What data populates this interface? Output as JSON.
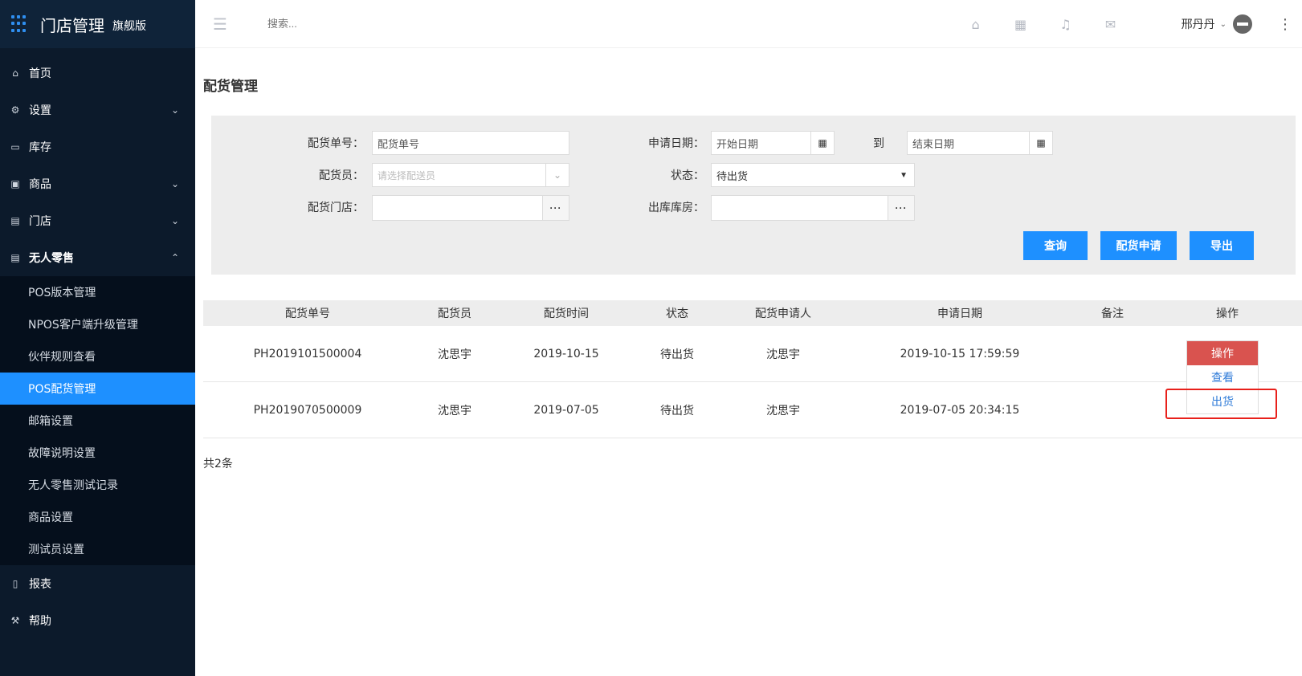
{
  "brand": {
    "title": "门店管理",
    "subtitle": "旗舰版"
  },
  "header": {
    "search_placeholder": "搜索...",
    "user_name": "邢丹丹"
  },
  "sidebar": {
    "items": [
      {
        "label": "首页"
      },
      {
        "label": "设置"
      },
      {
        "label": "库存"
      },
      {
        "label": "商品"
      },
      {
        "label": "门店"
      },
      {
        "label": "无人零售"
      }
    ],
    "sub_items": [
      {
        "label": "POS版本管理"
      },
      {
        "label": "NPOS客户端升级管理"
      },
      {
        "label": "伙伴规则查看"
      },
      {
        "label": "POS配货管理"
      },
      {
        "label": "邮箱设置"
      },
      {
        "label": "故障说明设置"
      },
      {
        "label": "无人零售测试记录"
      },
      {
        "label": "商品设置"
      },
      {
        "label": "测试员设置"
      }
    ],
    "bottom_items": [
      {
        "label": "报表"
      },
      {
        "label": "帮助"
      }
    ]
  },
  "page": {
    "title": "配货管理"
  },
  "filters": {
    "order_no_label": "配货单号：",
    "order_no_placeholder": "配货单号",
    "apply_date_label": "申请日期：",
    "start_date_placeholder": "开始日期",
    "to_label": "到",
    "end_date_placeholder": "结束日期",
    "distributor_label": "配货员：",
    "distributor_placeholder": "请选择配送员",
    "status_label": "状态：",
    "status_value": "待出货",
    "store_label": "配货门店：",
    "warehouse_label": "出库库房：",
    "more_glyph": "···"
  },
  "buttons": {
    "query": "查询",
    "apply": "配货申请",
    "export": "导出"
  },
  "table": {
    "headers": [
      "配货单号",
      "配货员",
      "配货时间",
      "状态",
      "配货申请人",
      "申请日期",
      "备注",
      "操作"
    ],
    "rows": [
      [
        "PH2019101500004",
        "沈思宇",
        "2019-10-15",
        "待出货",
        "沈思宇",
        "2019-10-15 17:59:59",
        ""
      ],
      [
        "PH2019070500009",
        "沈思宇",
        "2019-07-05",
        "待出货",
        "沈思宇",
        "2019-07-05 20:34:15",
        ""
      ]
    ]
  },
  "total_text": "共2条",
  "action_menu": {
    "title": "操作",
    "items": [
      "查看",
      "出货"
    ]
  },
  "colors": {
    "sidebar_bg": "#0c1a2b",
    "active": "#1e90ff",
    "danger": "#d9534f",
    "highlight": "#e8201b"
  }
}
